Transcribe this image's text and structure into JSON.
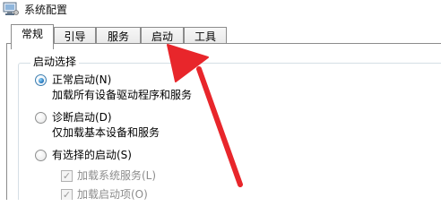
{
  "window": {
    "title": "系统配置",
    "icon": "system-config-icon"
  },
  "tabs": [
    {
      "label": "常规",
      "active": true
    },
    {
      "label": "引导",
      "active": false
    },
    {
      "label": "服务",
      "active": false
    },
    {
      "label": "启动",
      "active": false
    },
    {
      "label": "工具",
      "active": false
    }
  ],
  "startup_selection": {
    "group_label": "启动选择",
    "options": [
      {
        "label": "正常启动(N)",
        "description": "加载所有设备驱动程序和服务",
        "selected": true
      },
      {
        "label": "诊断启动(D)",
        "description": "仅加载基本设备和服务",
        "selected": false
      },
      {
        "label": "有选择的启动(S)",
        "selected": false
      }
    ],
    "selective_items": [
      {
        "label": "加载系统服务(L)",
        "checked": true,
        "enabled": false
      },
      {
        "label": "加载启动项(O)",
        "checked": true,
        "enabled": false
      }
    ]
  },
  "annotation": {
    "icon": "red-arrow-annotation",
    "color": "#e8262b",
    "points_to": "启动"
  }
}
